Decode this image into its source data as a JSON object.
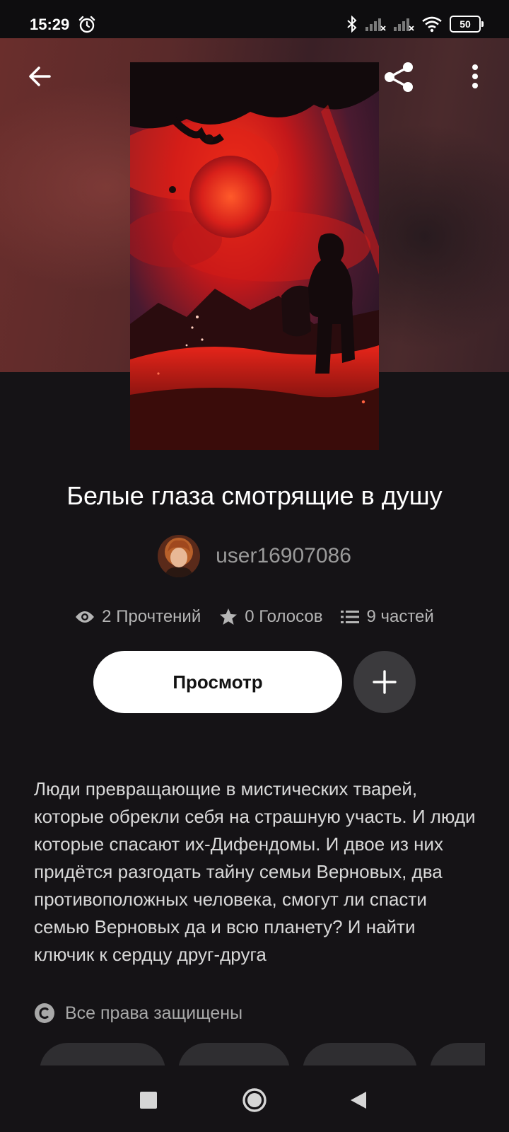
{
  "status_bar": {
    "time": "15:29",
    "battery_level": "50",
    "icons": [
      "alarm-icon",
      "bluetooth-icon",
      "signal-icon",
      "signal-icon",
      "wifi-icon",
      "battery-icon"
    ]
  },
  "header": {
    "icons": [
      "back-arrow-icon",
      "share-icon",
      "more-vertical-icon"
    ]
  },
  "story": {
    "title": "Белые глаза смотрящие в душу",
    "author": "user16907086",
    "stats": {
      "reads": "2 Прочтений",
      "votes": "0 Голосов",
      "parts": "9 частей"
    },
    "read_button_label": "Просмотр",
    "description": "Люди превращающие в мистических тварей, которые обрекли себя на страшную участь. И люди которые спасают их-Дифендомы. И двое из них придётся разгодать тайну семьи Верновых, два противоположных человека, смогут ли спасти семью Верновых да и всю планету? И найти ключик к сердцу друг-друга",
    "copyright": "Все права защищены"
  },
  "colors": {
    "background": "#151316",
    "primary_button": "#ffffff",
    "secondary_button": "#3b3a3d",
    "muted_text": "#9a9a9a"
  },
  "nav_bar": {
    "icons": [
      "recents-square-icon",
      "home-circle-icon",
      "back-triangle-icon"
    ]
  }
}
